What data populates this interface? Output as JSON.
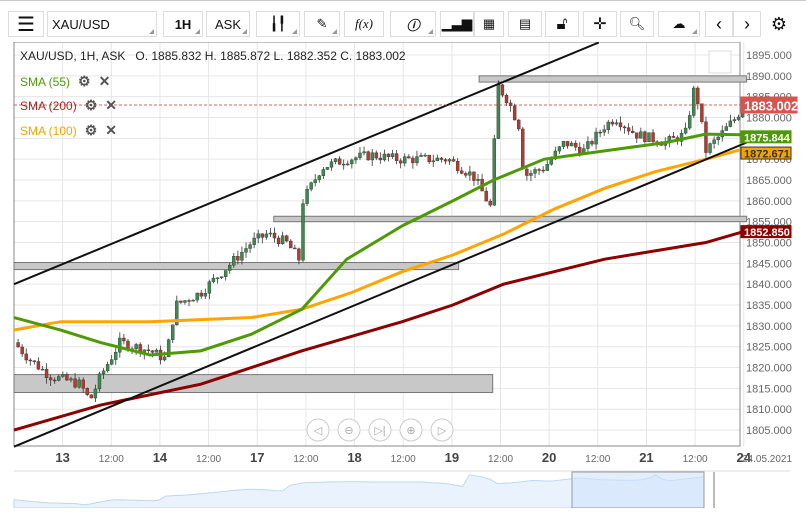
{
  "toolbar": {
    "menu_icon": "hamburger-icon",
    "symbol": "XAU/USD",
    "timeframe": "1H",
    "price_side": "ASK",
    "buttons": [
      "candlestick-icon",
      "pen-icon",
      "function-icon",
      "info-icon",
      "bar-chart-icon",
      "calendar-icon",
      "report-icon",
      "lock-icon",
      "crosshair-icon",
      "zoom-chart-icon",
      "cloud-upload-icon",
      "chevron-left-icon",
      "chevron-right-icon",
      "gear-icon"
    ],
    "fx_label": "f(x)"
  },
  "info": {
    "text": "XAU/USD, 1H, ASK   O. 1885.832 H. 1885.872 L. 1882.352 C. 1883.002"
  },
  "indicators": [
    {
      "label": "SMA (55)",
      "color": "#4e9a06"
    },
    {
      "label": "SMA (200)",
      "color": "#b22222"
    },
    {
      "label": "SMA (100)",
      "color": "#f5a300"
    }
  ],
  "chart_data": {
    "type": "candlestick",
    "price_ticks": [
      "1895.000",
      "1890.000",
      "1885.000",
      "1880.000",
      "1875.000",
      "1870.000",
      "1865.000",
      "1860.000",
      "1855.000",
      "1850.000",
      "1845.000",
      "1840.000",
      "1835.000",
      "1830.000",
      "1825.000",
      "1820.000",
      "1815.000",
      "1810.000",
      "1805.000"
    ],
    "ylim": [
      1800.5,
      1898
    ],
    "time_labels": [
      {
        "t": 0.5,
        "label": "13",
        "major": true
      },
      {
        "t": 1,
        "label": "12:00"
      },
      {
        "t": 1.5,
        "label": "14",
        "major": true
      },
      {
        "t": 2,
        "label": "12:00"
      },
      {
        "t": 2.5,
        "label": "17",
        "major": true
      },
      {
        "t": 3,
        "label": "12:00"
      },
      {
        "t": 3.5,
        "label": "18",
        "major": true
      },
      {
        "t": 4,
        "label": "12:00"
      },
      {
        "t": 4.5,
        "label": "19",
        "major": true
      },
      {
        "t": 5,
        "label": "12:00"
      },
      {
        "t": 5.5,
        "label": "20",
        "major": true
      },
      {
        "t": 6,
        "label": "12:00"
      },
      {
        "t": 6.5,
        "label": "21",
        "major": true
      },
      {
        "t": 7,
        "label": "12:00"
      },
      {
        "t": 7.5,
        "label": "24",
        "major": true
      }
    ],
    "end_date": "24.05.2021",
    "price_path": [
      [
        0,
        1826
      ],
      [
        0.16,
        1822
      ],
      [
        0.37,
        1818
      ],
      [
        0.68,
        1816
      ],
      [
        0.78,
        1812
      ],
      [
        0.89,
        1818
      ],
      [
        1.09,
        1826
      ],
      [
        1.4,
        1824
      ],
      [
        1.56,
        1822
      ],
      [
        1.66,
        1835
      ],
      [
        1.92,
        1838
      ],
      [
        2.23,
        1845
      ],
      [
        2.44,
        1850
      ],
      [
        2.6,
        1852
      ],
      [
        2.8,
        1850
      ],
      [
        2.93,
        1846
      ],
      [
        2.97,
        1860
      ],
      [
        3.16,
        1868
      ],
      [
        3.42,
        1870
      ],
      [
        3.68,
        1871
      ],
      [
        3.94,
        1870
      ],
      [
        4.2,
        1870
      ],
      [
        4.46,
        1870
      ],
      [
        4.72,
        1866
      ],
      [
        4.91,
        1858
      ],
      [
        4.96,
        1888
      ],
      [
        5.08,
        1884
      ],
      [
        5.19,
        1878
      ],
      [
        5.24,
        1866
      ],
      [
        5.45,
        1868
      ],
      [
        5.66,
        1874
      ],
      [
        5.86,
        1872
      ],
      [
        6.07,
        1878
      ],
      [
        6.18,
        1880
      ],
      [
        6.39,
        1876
      ],
      [
        6.7,
        1874
      ],
      [
        6.9,
        1876
      ],
      [
        7.0,
        1888
      ],
      [
        7.11,
        1872
      ],
      [
        7.27,
        1876
      ],
      [
        7.42,
        1880
      ],
      [
        7.5,
        1883
      ]
    ],
    "sma55": [
      [
        0,
        1832
      ],
      [
        0.48,
        1829
      ],
      [
        0.89,
        1826
      ],
      [
        1.4,
        1823
      ],
      [
        1.92,
        1824
      ],
      [
        2.44,
        1828
      ],
      [
        2.96,
        1834
      ],
      [
        3.42,
        1846
      ],
      [
        3.99,
        1854
      ],
      [
        4.51,
        1860
      ],
      [
        4.93,
        1865
      ],
      [
        5.45,
        1870
      ],
      [
        6.07,
        1872
      ],
      [
        6.7,
        1874
      ],
      [
        7.11,
        1876
      ],
      [
        7.53,
        1875.844
      ]
    ],
    "sma100": [
      [
        0,
        1829
      ],
      [
        0.48,
        1831
      ],
      [
        1.4,
        1831
      ],
      [
        2.44,
        1832
      ],
      [
        2.96,
        1834
      ],
      [
        3.47,
        1838
      ],
      [
        3.99,
        1843
      ],
      [
        4.51,
        1847
      ],
      [
        5.03,
        1852
      ],
      [
        5.55,
        1858
      ],
      [
        6.07,
        1863
      ],
      [
        6.59,
        1867
      ],
      [
        7.11,
        1870
      ],
      [
        7.53,
        1872.671
      ]
    ],
    "sma200": [
      [
        0,
        1805
      ],
      [
        0.89,
        1811
      ],
      [
        1.92,
        1816
      ],
      [
        2.44,
        1820
      ],
      [
        2.96,
        1824
      ],
      [
        3.99,
        1831
      ],
      [
        4.51,
        1835
      ],
      [
        5.03,
        1840
      ],
      [
        6.07,
        1846
      ],
      [
        7.11,
        1850
      ],
      [
        7.53,
        1852.85
      ]
    ],
    "trendlines": [
      [
        [
          0,
          1840
        ],
        [
          6.01,
          1898
        ]
      ],
      [
        [
          0,
          1801
        ],
        [
          7.53,
          1874
        ]
      ]
    ],
    "zones": [
      [
        4.78,
        7.53,
        1888.5,
        1890
      ],
      [
        2.67,
        7.53,
        1855,
        1856.3
      ],
      [
        0,
        4.57,
        1843.5,
        1845.2
      ],
      [
        0,
        4.92,
        1814,
        1818.3
      ]
    ],
    "last_price": "1883.002",
    "labels": [
      {
        "value": "1883.002",
        "color": "#d9534f"
      },
      {
        "value": "1875.844",
        "color": "#4e9a06"
      },
      {
        "value": "1872.671",
        "color": "#f5a300"
      },
      {
        "value": "1852.850",
        "color": "#8b0000"
      }
    ]
  },
  "nav_buttons": [
    "chevron-left-icon",
    "zoom-out-icon",
    "skip-end-icon",
    "zoom-in-icon",
    "chevron-right-icon"
  ]
}
